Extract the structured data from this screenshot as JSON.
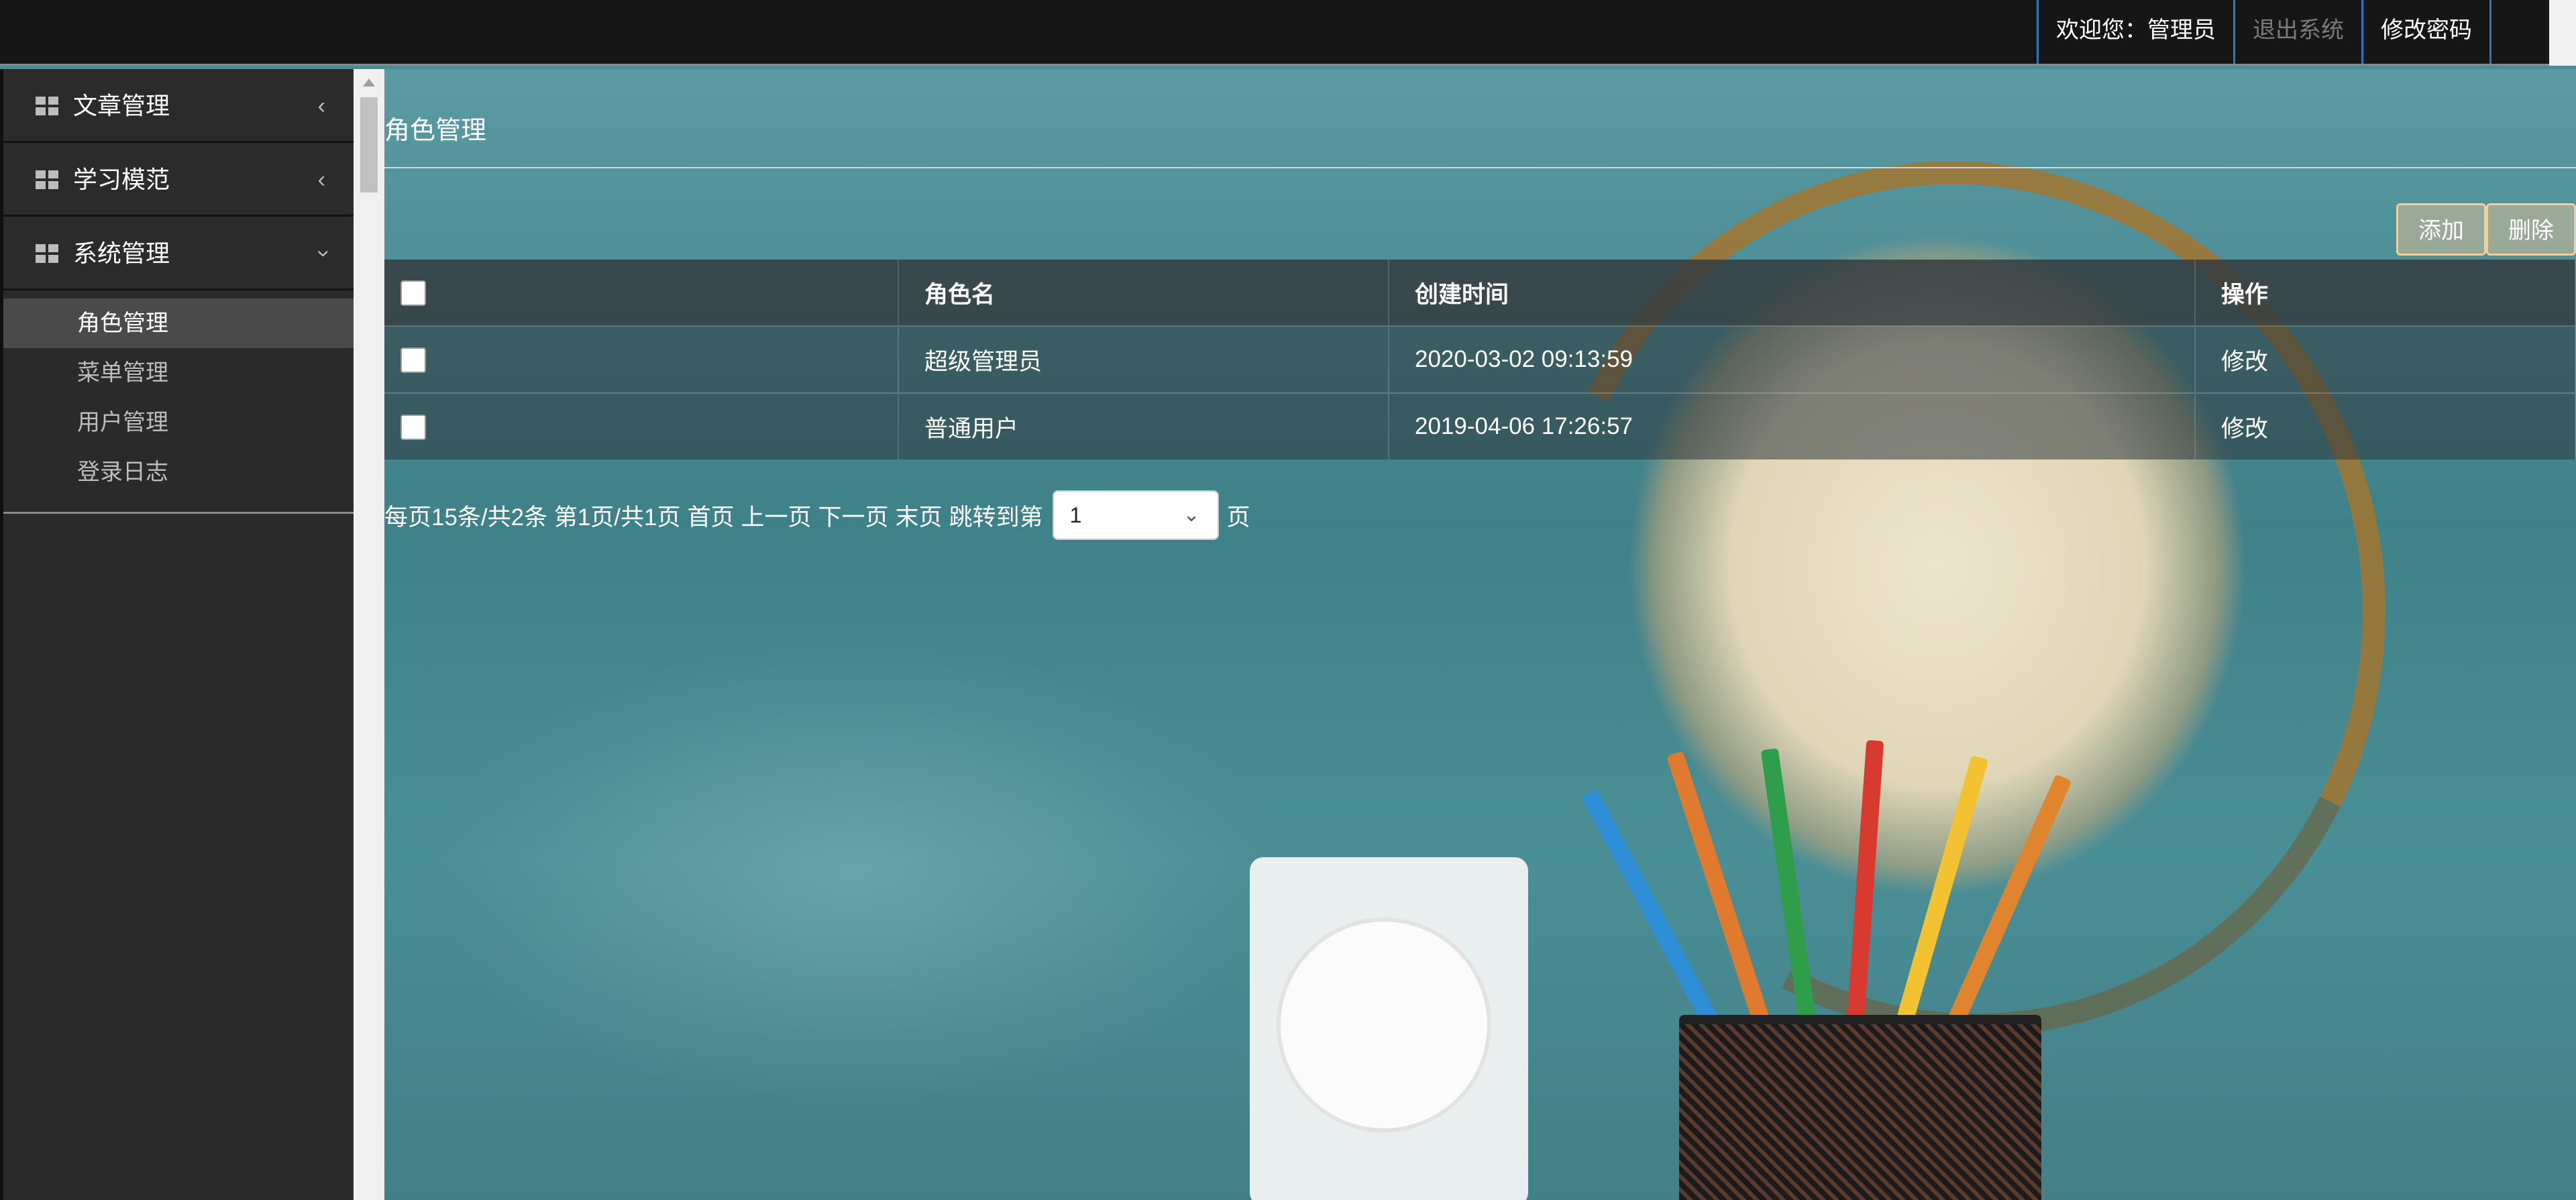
{
  "topbar": {
    "welcome": "欢迎您：管理员",
    "logout": "退出系统",
    "change_password": "修改密码"
  },
  "sidebar": {
    "menus": [
      {
        "label": "文章管理",
        "expanded": false
      },
      {
        "label": "学习模范",
        "expanded": false
      },
      {
        "label": "系统管理",
        "expanded": true
      }
    ],
    "submenu": [
      {
        "label": "角色管理",
        "active": true
      },
      {
        "label": "菜单管理",
        "active": false
      },
      {
        "label": "用户管理",
        "active": false
      },
      {
        "label": "登录日志",
        "active": false
      }
    ]
  },
  "main": {
    "title": "角色管理",
    "buttons": {
      "add": "添加",
      "delete": "删除"
    },
    "table": {
      "headers": [
        "",
        "角色名",
        "创建时间",
        "操作"
      ],
      "rows": [
        {
          "name": "超级管理员",
          "created": "2020-03-02 09:13:59",
          "action": "修改"
        },
        {
          "name": "普通用户",
          "created": "2019-04-06 17:26:57",
          "action": "修改"
        }
      ]
    },
    "pager": {
      "summary": "每页15条/共2条 第1页/共1页",
      "first": "首页",
      "prev": "上一页",
      "next": "下一页",
      "last": "末页",
      "jump_prefix": "跳转到第",
      "jump_value": "1",
      "jump_suffix": "页"
    }
  },
  "colors": {
    "topbar_bg": "#161616",
    "sidebar_bg": "#2a2a2a",
    "topnav_divider": "#2e76b8"
  }
}
